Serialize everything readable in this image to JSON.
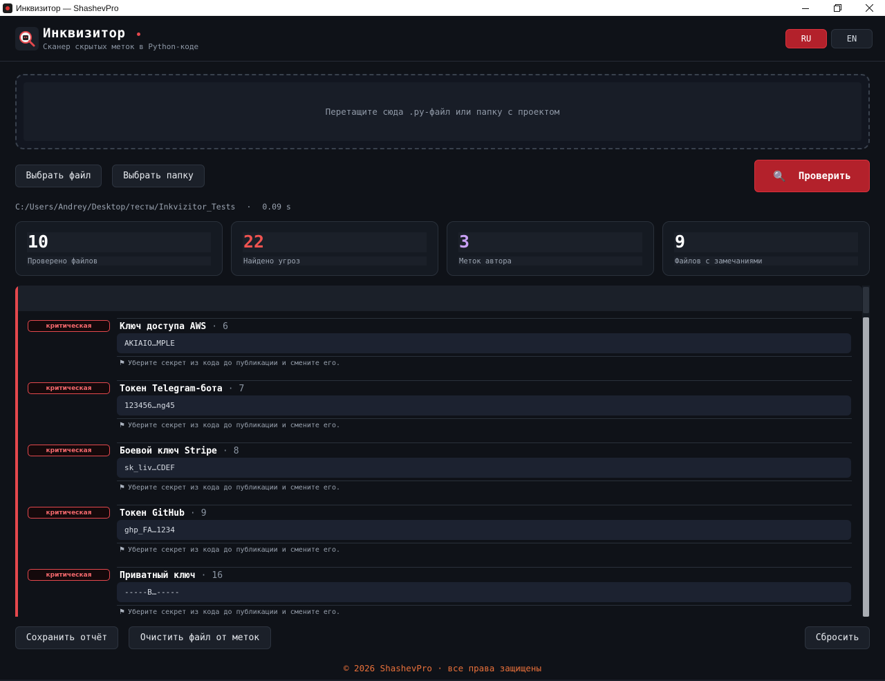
{
  "window": {
    "title": "Инквизитор — ShashevPro"
  },
  "header": {
    "app_name": "Инквизитор",
    "subtitle": "Сканер скрытых меток в Python-коде",
    "lang_ru": "RU",
    "lang_en": "EN",
    "active_lang": "RU"
  },
  "dropzone": {
    "text": "Перетащите сюда .py-файл или папку с проектом"
  },
  "actions": {
    "choose_file": "Выбрать файл",
    "choose_folder": "Выбрать папку",
    "check": "Проверить"
  },
  "scan": {
    "path": "C:/Users/Andrey/Desktop/тесты/Inkvizitor_Tests",
    "separator": "·",
    "duration": "0.09 s"
  },
  "stats": [
    {
      "value": "10",
      "label": "Проверено файлов",
      "color": "#ffffff"
    },
    {
      "value": "22",
      "label": "Найдено угроз",
      "color": "#ef5350"
    },
    {
      "value": "3",
      "label": "Меток автора",
      "color": "#c9a0f5"
    },
    {
      "value": "9",
      "label": "Файлов с замечаниями",
      "color": "#ffffff"
    }
  ],
  "findings": [
    {
      "severity": "критическая",
      "title": "Ключ доступа AWS",
      "sep": "·",
      "line": "6",
      "snippet": "AKIAIO…MPLE",
      "advice": "Уберите секрет из кода до публикации и смените его."
    },
    {
      "severity": "критическая",
      "title": "Токен Telegram-бота",
      "sep": "·",
      "line": "7",
      "snippet": "123456…ng45",
      "advice": "Уберите секрет из кода до публикации и смените его."
    },
    {
      "severity": "критическая",
      "title": "Боевой ключ Stripe",
      "sep": "·",
      "line": "8",
      "snippet": "sk_liv…CDEF",
      "advice": "Уберите секрет из кода до публикации и смените его."
    },
    {
      "severity": "критическая",
      "title": "Токен GitHub",
      "sep": "·",
      "line": "9",
      "snippet": "ghp_FA…1234",
      "advice": "Уберите секрет из кода до публикации и смените его."
    },
    {
      "severity": "критическая",
      "title": "Приватный ключ",
      "sep": "·",
      "line": "16",
      "snippet": "-----B…-----",
      "advice": "Уберите секрет из кода до публикации и смените его."
    }
  ],
  "bottom": {
    "save_report": "Сохранить отчёт",
    "clean_file": "Очистить файл от меток",
    "reset": "Сбросить"
  },
  "footer": {
    "text": "© 2026 ShashevPro · все права защищены"
  },
  "colors": {
    "accent": "#b3212b",
    "danger": "#e5484d",
    "footer": "#e8703a"
  },
  "icons": {
    "app": "inquisitor-logo-icon",
    "check": "magnifier-icon",
    "advice": "flag-icon"
  }
}
